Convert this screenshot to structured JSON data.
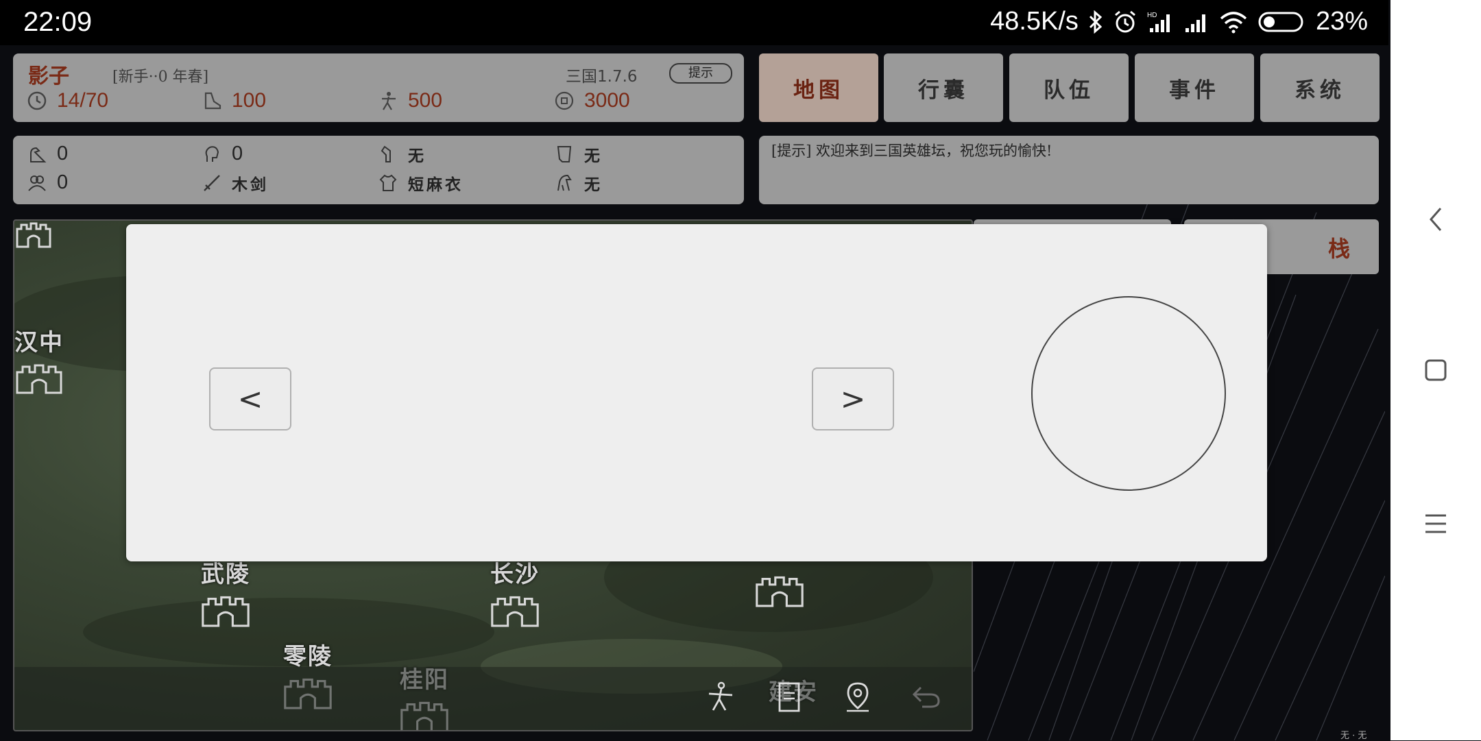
{
  "status": {
    "time": "22:09",
    "speed": "48.5K/s",
    "battery": "23%"
  },
  "player": {
    "name": "影子",
    "rank": "[新手··0 年春]",
    "version": "三国1.7.6",
    "hint_button": "提示",
    "stats": {
      "time": "14/70",
      "stamina": "100",
      "hp": "500",
      "money": "3000"
    }
  },
  "attributes": {
    "attr1": "0",
    "attr2": "0",
    "attr3": "0",
    "head": "无",
    "body_item": "无",
    "weapon": "木剑",
    "armor": "短麻衣",
    "mount": "无"
  },
  "tabs": [
    {
      "label": "地图",
      "active": true
    },
    {
      "label": "行囊",
      "active": false
    },
    {
      "label": "队伍",
      "active": false
    },
    {
      "label": "事件",
      "active": false
    },
    {
      "label": "系统",
      "active": false
    }
  ],
  "message": "[提示] 欢迎来到三国英雄坛，祝您玩的愉快!",
  "stack_button": "栈",
  "map": {
    "cities": [
      "汉中",
      "武陵",
      "长沙",
      "零陵",
      "桂阳",
      "建安"
    ]
  },
  "dialog": {
    "prev_label": "<",
    "next_label": ">"
  },
  "footer": "无 · 无",
  "colors": {
    "accent": "#7a2a16",
    "panel": "#9a9a9a",
    "active_tab": "#b4a197"
  }
}
